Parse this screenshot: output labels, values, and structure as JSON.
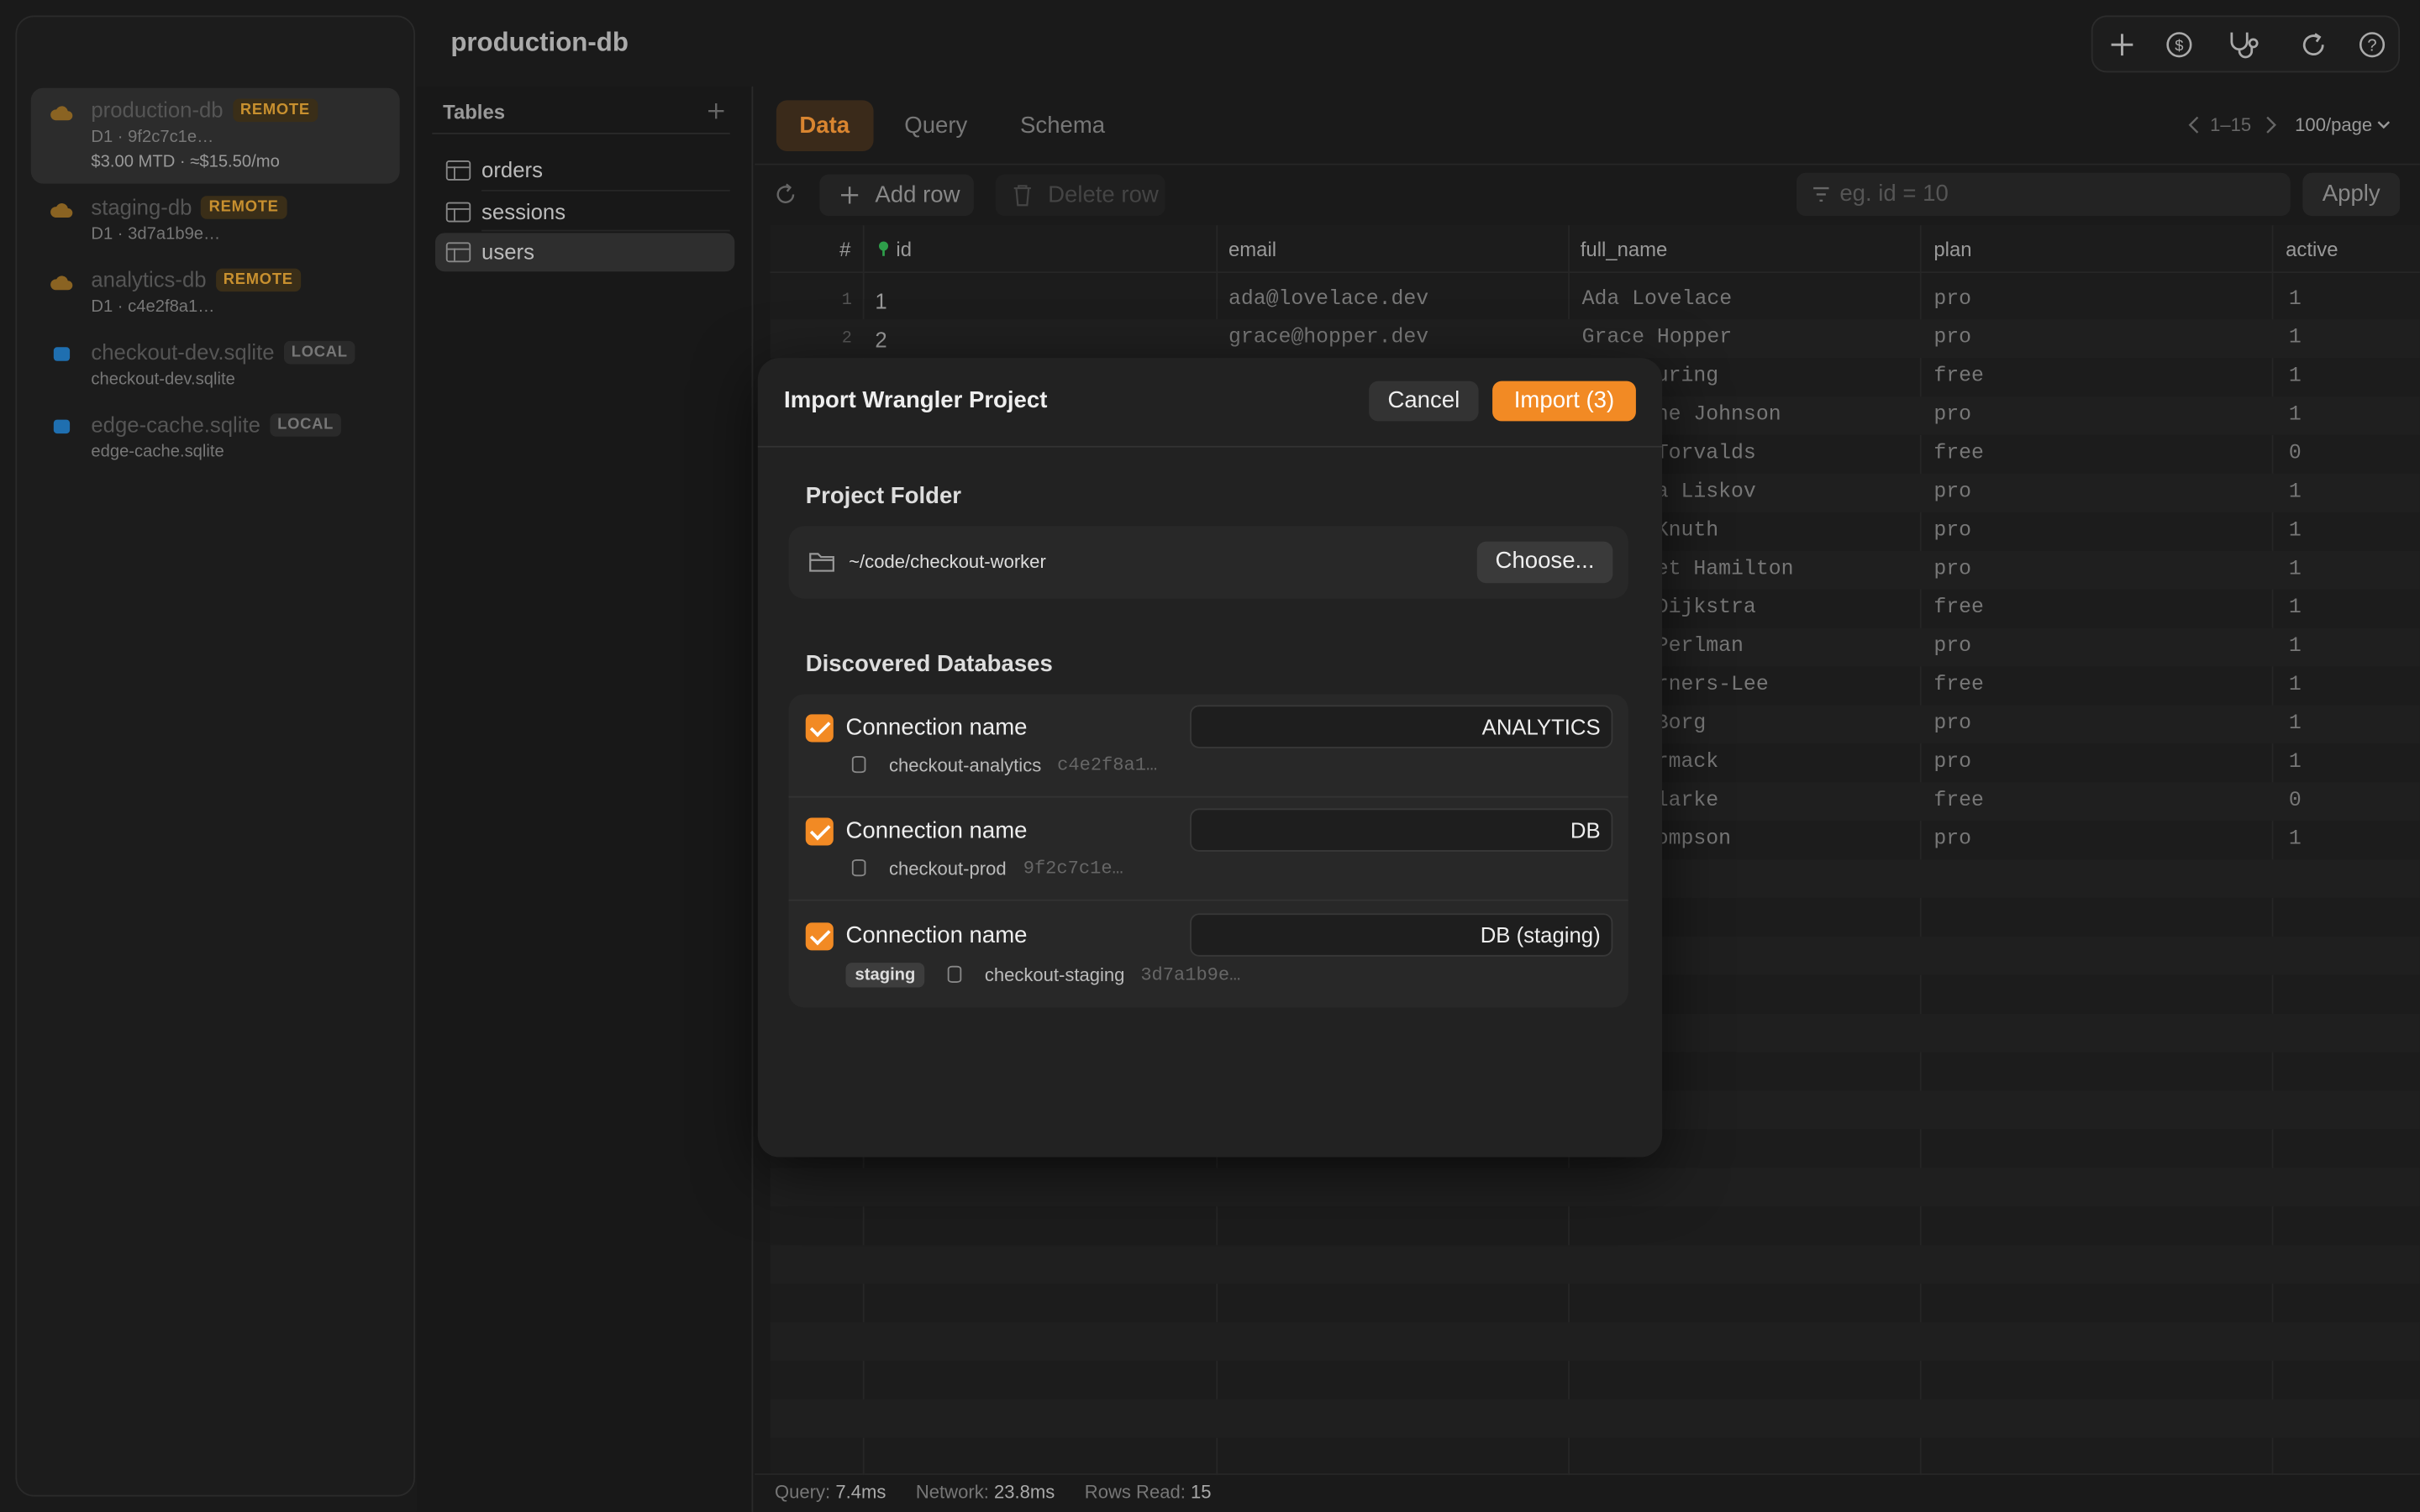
{
  "window": {
    "title": "production-db"
  },
  "sidebar": {
    "connections": [
      {
        "name": "production-db",
        "badge": "REMOTE",
        "line1": "D1 · 9f2c7c1e…",
        "line2": "$3.00 MTD · ≈$15.50/mo",
        "type": "remote",
        "selected": true
      },
      {
        "name": "staging-db",
        "badge": "REMOTE",
        "line1": "D1 · 3d7a1b9e…",
        "type": "remote"
      },
      {
        "name": "analytics-db",
        "badge": "REMOTE",
        "line1": "D1 · c4e2f8a1…",
        "type": "remote"
      },
      {
        "name": "checkout-dev.sqlite",
        "badge": "LOCAL",
        "line1": "checkout-dev.sqlite",
        "type": "local"
      },
      {
        "name": "edge-cache.sqlite",
        "badge": "LOCAL",
        "line1": "edge-cache.sqlite",
        "type": "local"
      }
    ]
  },
  "tables": {
    "title": "Tables",
    "items": [
      "orders",
      "sessions",
      "users"
    ],
    "selected": "users"
  },
  "main": {
    "tabs": [
      "Data",
      "Query",
      "Schema"
    ],
    "active_tab": "Data",
    "pagination": "1–15",
    "per_page": "100/page",
    "add_row": "Add row",
    "delete_row": "Delete row",
    "filter_placeholder": "eg. id = 10",
    "apply": "Apply",
    "columns": [
      "#",
      "id",
      "email",
      "full_name",
      "plan",
      "active"
    ],
    "rows": [
      [
        "1",
        "1",
        "ada@lovelace.dev",
        "Ada Lovelace",
        "pro",
        "1"
      ],
      [
        "2",
        "2",
        "grace@hopper.dev",
        "Grace Hopper",
        "pro",
        "1"
      ],
      [
        "",
        "",
        "",
        "uring",
        "free",
        "1"
      ],
      [
        "",
        "",
        "",
        "ne Johnson",
        "pro",
        "1"
      ],
      [
        "",
        "",
        "",
        "Torvalds",
        "free",
        "0"
      ],
      [
        "",
        "",
        "",
        "a Liskov",
        "pro",
        "1"
      ],
      [
        "",
        "",
        "",
        "Knuth",
        "pro",
        "1"
      ],
      [
        "",
        "",
        "",
        "et Hamilton",
        "pro",
        "1"
      ],
      [
        "",
        "",
        "",
        "Dijkstra",
        "free",
        "1"
      ],
      [
        "",
        "",
        "",
        "Perlman",
        "pro",
        "1"
      ],
      [
        "",
        "",
        "",
        "rners-Lee",
        "free",
        "1"
      ],
      [
        "",
        "",
        "",
        "Borg",
        "pro",
        "1"
      ],
      [
        "",
        "",
        "",
        "rmack",
        "pro",
        "1"
      ],
      [
        "",
        "",
        "",
        "larke",
        "free",
        "0"
      ],
      [
        "",
        "",
        "",
        "ompson",
        "pro",
        "1"
      ]
    ],
    "status": {
      "query_label": "Query:",
      "query": "7.4ms",
      "network_label": "Network:",
      "network": "23.8ms",
      "rows_label": "Rows Read:",
      "rows": "15"
    }
  },
  "modal": {
    "title": "Import Wrangler Project",
    "cancel": "Cancel",
    "import": "Import (3)",
    "folder_heading": "Project Folder",
    "folder_path": "~/code/checkout-worker",
    "choose": "Choose...",
    "discovered_heading": "Discovered Databases",
    "databases": [
      {
        "label": "Connection name",
        "value": "ANALYTICS",
        "db": "checkout-analytics",
        "id": "c4e2f8a1…",
        "env": ""
      },
      {
        "label": "Connection name",
        "value": "DB",
        "db": "checkout-prod",
        "id": "9f2c7c1e…",
        "env": ""
      },
      {
        "label": "Connection name",
        "value": "DB (staging)",
        "db": "checkout-staging",
        "id": "3d7a1b9e…",
        "env": "staging"
      }
    ]
  },
  "colors": {
    "accent": "#f28a24",
    "remote": "#c8902f",
    "local": "#2e7fc4"
  }
}
